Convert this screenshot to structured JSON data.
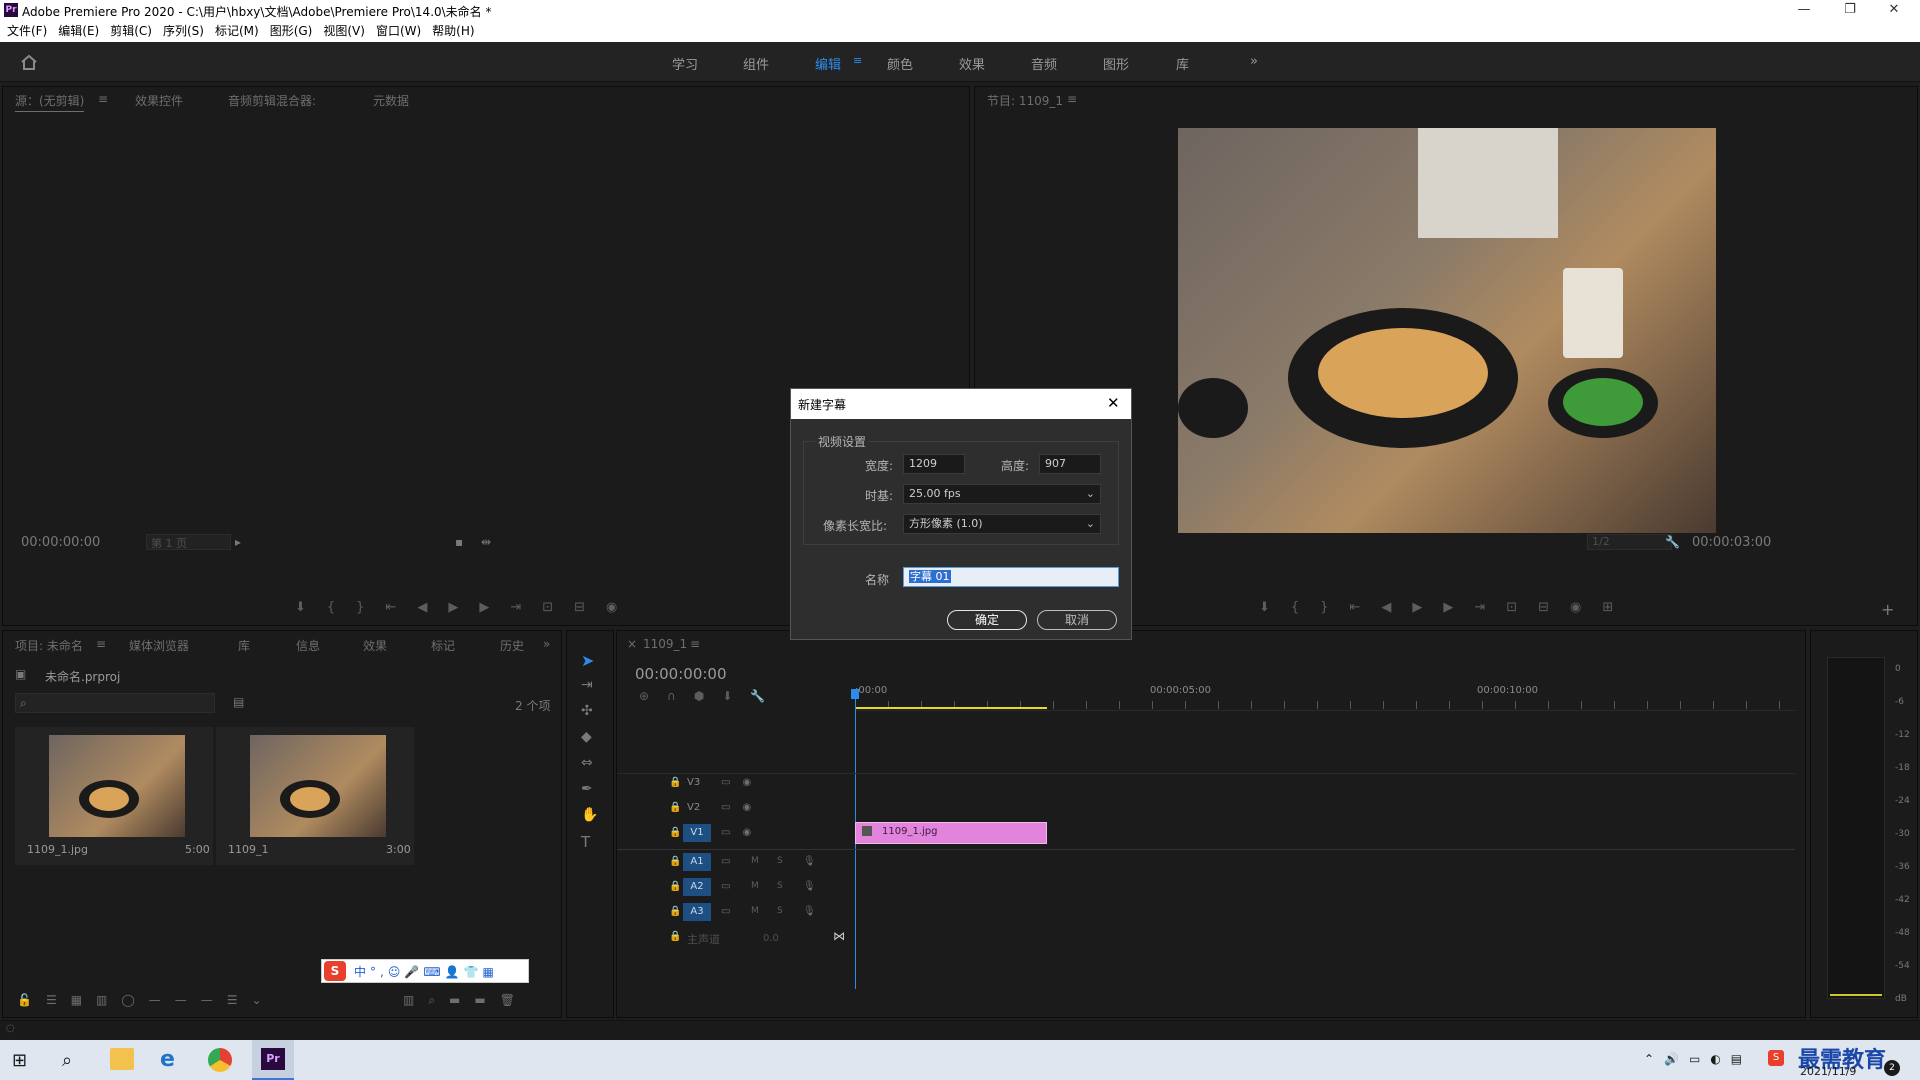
{
  "app": {
    "title": "Adobe Premiere Pro 2020 - C:\\用户\\hbxy\\文档\\Adobe\\Premiere Pro\\14.0\\未命名 *",
    "logo_text": "Pr"
  },
  "window_controls": {
    "minimize": "—",
    "maximize": "❐",
    "close": "✕"
  },
  "menu": [
    "文件(F)",
    "编辑(E)",
    "剪辑(C)",
    "序列(S)",
    "标记(M)",
    "图形(G)",
    "视图(V)",
    "窗口(W)",
    "帮助(H)"
  ],
  "workspaces": [
    {
      "label": "学习",
      "active": false
    },
    {
      "label": "组件",
      "active": false
    },
    {
      "label": "编辑",
      "active": true
    },
    {
      "label": "颜色",
      "active": false
    },
    {
      "label": "效果",
      "active": false
    },
    {
      "label": "音频",
      "active": false
    },
    {
      "label": "图形",
      "active": false
    },
    {
      "label": "库",
      "active": false
    }
  ],
  "source_panel": {
    "tabs": [
      "源：(无剪辑)",
      "效果控件",
      "音频剪辑混合器:",
      "元数据"
    ],
    "timecode": "00:00:00:00",
    "page_select": "第 1 页"
  },
  "program_panel": {
    "tab": "节目: 1109_1",
    "timecode": "00:00:03:00",
    "zoom_select": "1/2"
  },
  "project_panel": {
    "tabs": [
      "项目: 未命名",
      "媒体浏览器",
      "库",
      "信息",
      "效果",
      "标记",
      "历史"
    ],
    "project_name": "未命名.prproj",
    "item_count": "2 个项",
    "items": [
      {
        "name": "1109_1.jpg",
        "duration": "5:00"
      },
      {
        "name": "1109_1",
        "duration": "3:00"
      }
    ]
  },
  "ime_bar": {
    "items": [
      "中",
      "°,",
      "☺",
      "🎤",
      "⌨",
      "👤",
      "👕",
      "▦"
    ]
  },
  "timeline": {
    "tab": "1109_1",
    "timecode": "00:00:00:00",
    "ruler": [
      ":00:00",
      "00:00:05:00",
      "00:00:10:00"
    ],
    "video_tracks": [
      "V3",
      "V2",
      "V1"
    ],
    "audio_tracks": [
      "A1",
      "A2",
      "A3"
    ],
    "master": {
      "label": "主声道",
      "value": "0.0"
    },
    "clip": {
      "name": "1109_1.jpg",
      "track": "V1"
    },
    "audio_buttons": {
      "mute": "M",
      "solo": "S"
    }
  },
  "audio_meter": {
    "labels": [
      "0",
      "-6",
      "-12",
      "-18",
      "-24",
      "-30",
      "-36",
      "-42",
      "-48",
      "-54",
      "dB"
    ]
  },
  "dialog": {
    "title": "新建字幕",
    "group_label": "视频设置",
    "width_label": "宽度:",
    "width_value": "1209",
    "height_label": "高度:",
    "height_value": "907",
    "timebase_label": "时基:",
    "timebase_value": "25.00 fps",
    "pixel_aspect_label": "像素长宽比:",
    "pixel_aspect_value": "方形像素 (1.0)",
    "name_label": "名称",
    "name_value": "字幕 01",
    "ok_label": "确定",
    "cancel_label": "取消"
  },
  "taskbar": {
    "date": "2021/11/9",
    "watermark": "最需教育",
    "notification_count": "2"
  },
  "colors": {
    "accent_blue": "#2d8ceb",
    "clip_pink": "#e284dc",
    "track_blue": "#1d4f83",
    "work_area_yellow": "#e5d92e"
  }
}
